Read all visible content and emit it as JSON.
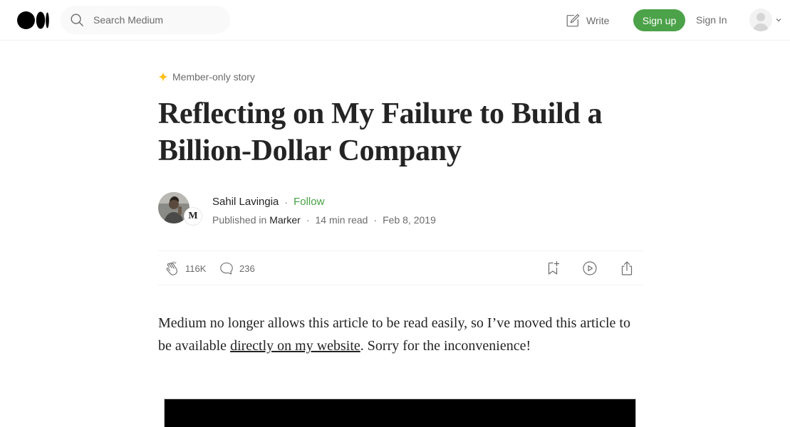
{
  "header": {
    "logo": "medium-logo",
    "search_placeholder": "Search Medium",
    "write_label": "Write",
    "signup_label": "Sign up",
    "signin_label": "Sign In"
  },
  "article": {
    "member_label": "Member-only story",
    "title": "Reflecting on My Failure to Build a Billion-Dollar Company",
    "author": "Sahil Lavingia",
    "follow_label": "Follow",
    "published_in": "Published in",
    "publication": "Marker",
    "publication_badge": "M",
    "read_time": "14 min read",
    "date": "Feb 8, 2019",
    "claps": "116K",
    "responses": "236",
    "body_before": "Medium no longer allows this article to be read easily, so I’ve moved this article to be available ",
    "body_link": "directly on my website",
    "body_after": ". Sorry for the inconvenience!"
  },
  "colors": {
    "accent": "#1a8917",
    "member_star": "#ffc017",
    "muted": "#6b6b6b"
  }
}
